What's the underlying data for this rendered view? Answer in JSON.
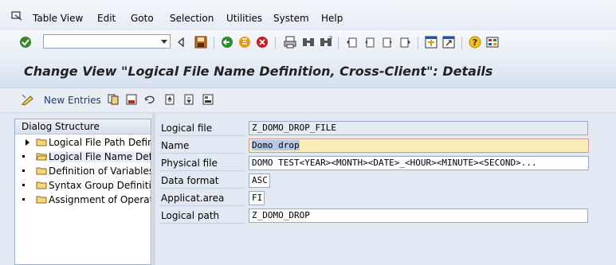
{
  "menubar": {
    "items": [
      "Table View",
      "Edit",
      "Goto",
      "Selection",
      "Utilities",
      "System",
      "Help"
    ]
  },
  "toolbar": {
    "command_field_value": "",
    "buttons": [
      "enter-icon",
      "back-arrow-icon",
      "save-icon",
      "back-icon",
      "exit-icon",
      "cancel-icon",
      "print-icon",
      "find-icon",
      "find-next-icon",
      "first-page-icon",
      "previous-page-icon",
      "next-page-icon",
      "last-page-icon",
      "create-session-icon",
      "shortcut-icon",
      "help-icon",
      "layout-icon"
    ]
  },
  "title": {
    "text": "Change View \"Logical File Name Definition, Cross-Client\": Details"
  },
  "appbar": {
    "new_entries_label": "New Entries"
  },
  "tree": {
    "header": "Dialog Structure",
    "items": [
      {
        "label": "Logical File Path Definit"
      },
      {
        "label": "Logical File Name Defini",
        "selected": true
      },
      {
        "label": "Definition of Variables"
      },
      {
        "label": "Syntax Group Definitior"
      },
      {
        "label": "Assignment of Operatir"
      }
    ]
  },
  "form": {
    "fields": [
      {
        "label": "Logical file",
        "value": "Z_DOMO_DROP_FILE"
      },
      {
        "label": "Name",
        "value": "Domo drop"
      },
      {
        "label": "Physical file",
        "value": "DOMO TEST<YEAR><MONTH><DATE>_<HOUR><MINUTE><SECOND>..."
      },
      {
        "label": "Data format",
        "value": "ASC"
      },
      {
        "label": "Applicat.area",
        "value": "FI"
      },
      {
        "label": "Logical path",
        "value": "Z_DOMO_DROP"
      }
    ]
  },
  "colors": {
    "title_text": "#222222",
    "focused_field": "#fcedb8",
    "background": "#dfe6f1"
  }
}
